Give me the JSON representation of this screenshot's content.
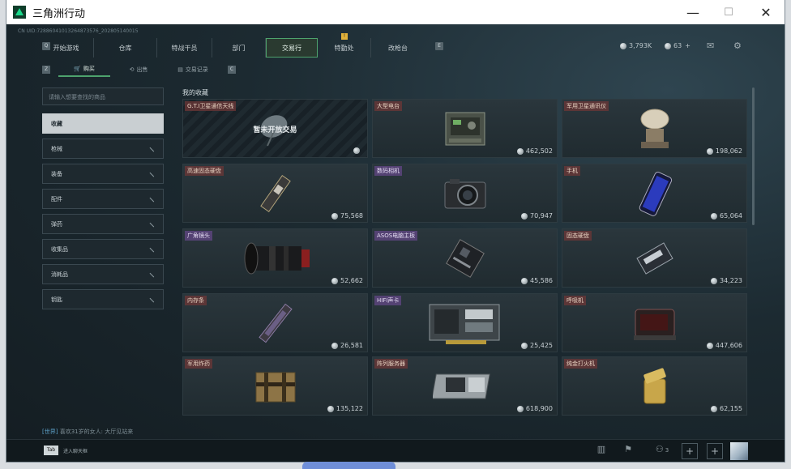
{
  "window": {
    "title": "三角洲行动",
    "minimize": "—",
    "maximize": "☐",
    "close": "✕"
  },
  "uid_text": "CN UID:7288604101326487357​6_2028051400​15",
  "nav": {
    "prev_key": "Q",
    "next_key": "E",
    "tabs": [
      {
        "label": "开始游戏"
      },
      {
        "label": "仓库"
      },
      {
        "label": "特战干员"
      },
      {
        "label": "部门"
      },
      {
        "label": "交易行"
      },
      {
        "label": "特勤处"
      },
      {
        "label": "改枪台"
      }
    ],
    "badge": "!"
  },
  "currency": {
    "coins": "3,793K",
    "tickets": "63",
    "add": "+"
  },
  "subtabs": {
    "prev_key": "Z",
    "next_key": "C",
    "items": [
      {
        "label": "购买"
      },
      {
        "label": "出售"
      },
      {
        "label": "交易记录"
      }
    ]
  },
  "search": {
    "placeholder": "请输入想要查找的商品"
  },
  "filters": [
    {
      "label": "收藏"
    },
    {
      "label": "枪械"
    },
    {
      "label": "装备"
    },
    {
      "label": "配件"
    },
    {
      "label": "弹药"
    },
    {
      "label": "收集品"
    },
    {
      "label": "消耗品"
    },
    {
      "label": "钥匙"
    }
  ],
  "section_title": "我的收藏",
  "items": [
    {
      "name": "G.T.I卫星通信天线",
      "price": "",
      "locked_text": "暂未开放交易",
      "icon": "satellite-dish-icon"
    },
    {
      "name": "大型电台",
      "price": "462,502",
      "icon": "radio-station-icon"
    },
    {
      "name": "军用卫星通讯仪",
      "price": "198,062",
      "icon": "satellite-comm-icon"
    },
    {
      "name": "高速固态硬盘",
      "price": "75,568",
      "icon": "ssd-icon"
    },
    {
      "name": "数码相机",
      "price": "70,947",
      "icon": "camera-icon"
    },
    {
      "name": "手机",
      "price": "65,064",
      "icon": "phone-icon"
    },
    {
      "name": "广角镜头",
      "price": "52,662",
      "icon": "lens-icon"
    },
    {
      "name": "ASOS电脑主板",
      "price": "45,586",
      "icon": "motherboard-icon"
    },
    {
      "name": "固态硬盘",
      "price": "34,223",
      "icon": "ssd-box-icon"
    },
    {
      "name": "内存条",
      "price": "26,581",
      "icon": "ram-icon"
    },
    {
      "name": "HIFI声卡",
      "price": "25,425",
      "icon": "sound-card-icon"
    },
    {
      "name": "呼吸机",
      "price": "447,606",
      "icon": "ventilator-icon"
    },
    {
      "name": "军用炸药",
      "price": "135,122",
      "icon": "explosive-icon"
    },
    {
      "name": "阵列服务器",
      "price": "618,900",
      "icon": "server-icon"
    },
    {
      "name": "纯金打火机",
      "price": "62,155",
      "icon": "lighter-icon"
    }
  ],
  "chat": {
    "channel": "[世界]",
    "message": "喜欢31岁的女人: 大厅见站来"
  },
  "bottom": {
    "tab_key": "Tab",
    "chat_button": "进入聊天框",
    "friends": "3",
    "plus": "+"
  }
}
